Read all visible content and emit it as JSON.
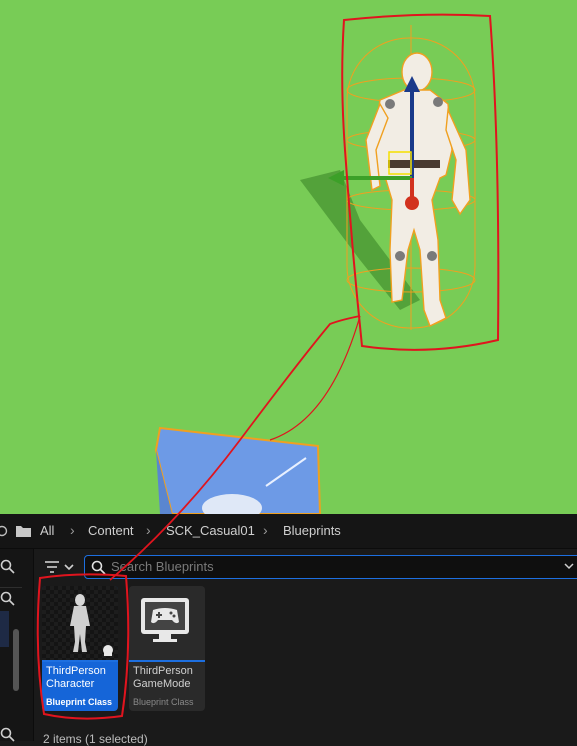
{
  "breadcrumb": {
    "items": [
      "All",
      "Content",
      "SCK_Casual01",
      "Blueprints"
    ]
  },
  "search": {
    "placeholder": "Search Blueprints"
  },
  "assets": [
    {
      "name_line1": "ThirdPerson",
      "name_line2": "Character",
      "type": "Blueprint Class",
      "selected": true,
      "icon": "mannequin-thumbnail"
    },
    {
      "name_line1": "ThirdPerson",
      "name_line2": "GameMode",
      "type": "Blueprint Class",
      "selected": false,
      "icon": "gamepad-monitor-icon"
    }
  ],
  "status": {
    "text": "2 items (1 selected)"
  },
  "colors": {
    "viewport_ground": "#78cc56",
    "selection_accent": "#1565d8",
    "annotation_red": "#e0141e",
    "bounds_orange": "#f0a020"
  }
}
